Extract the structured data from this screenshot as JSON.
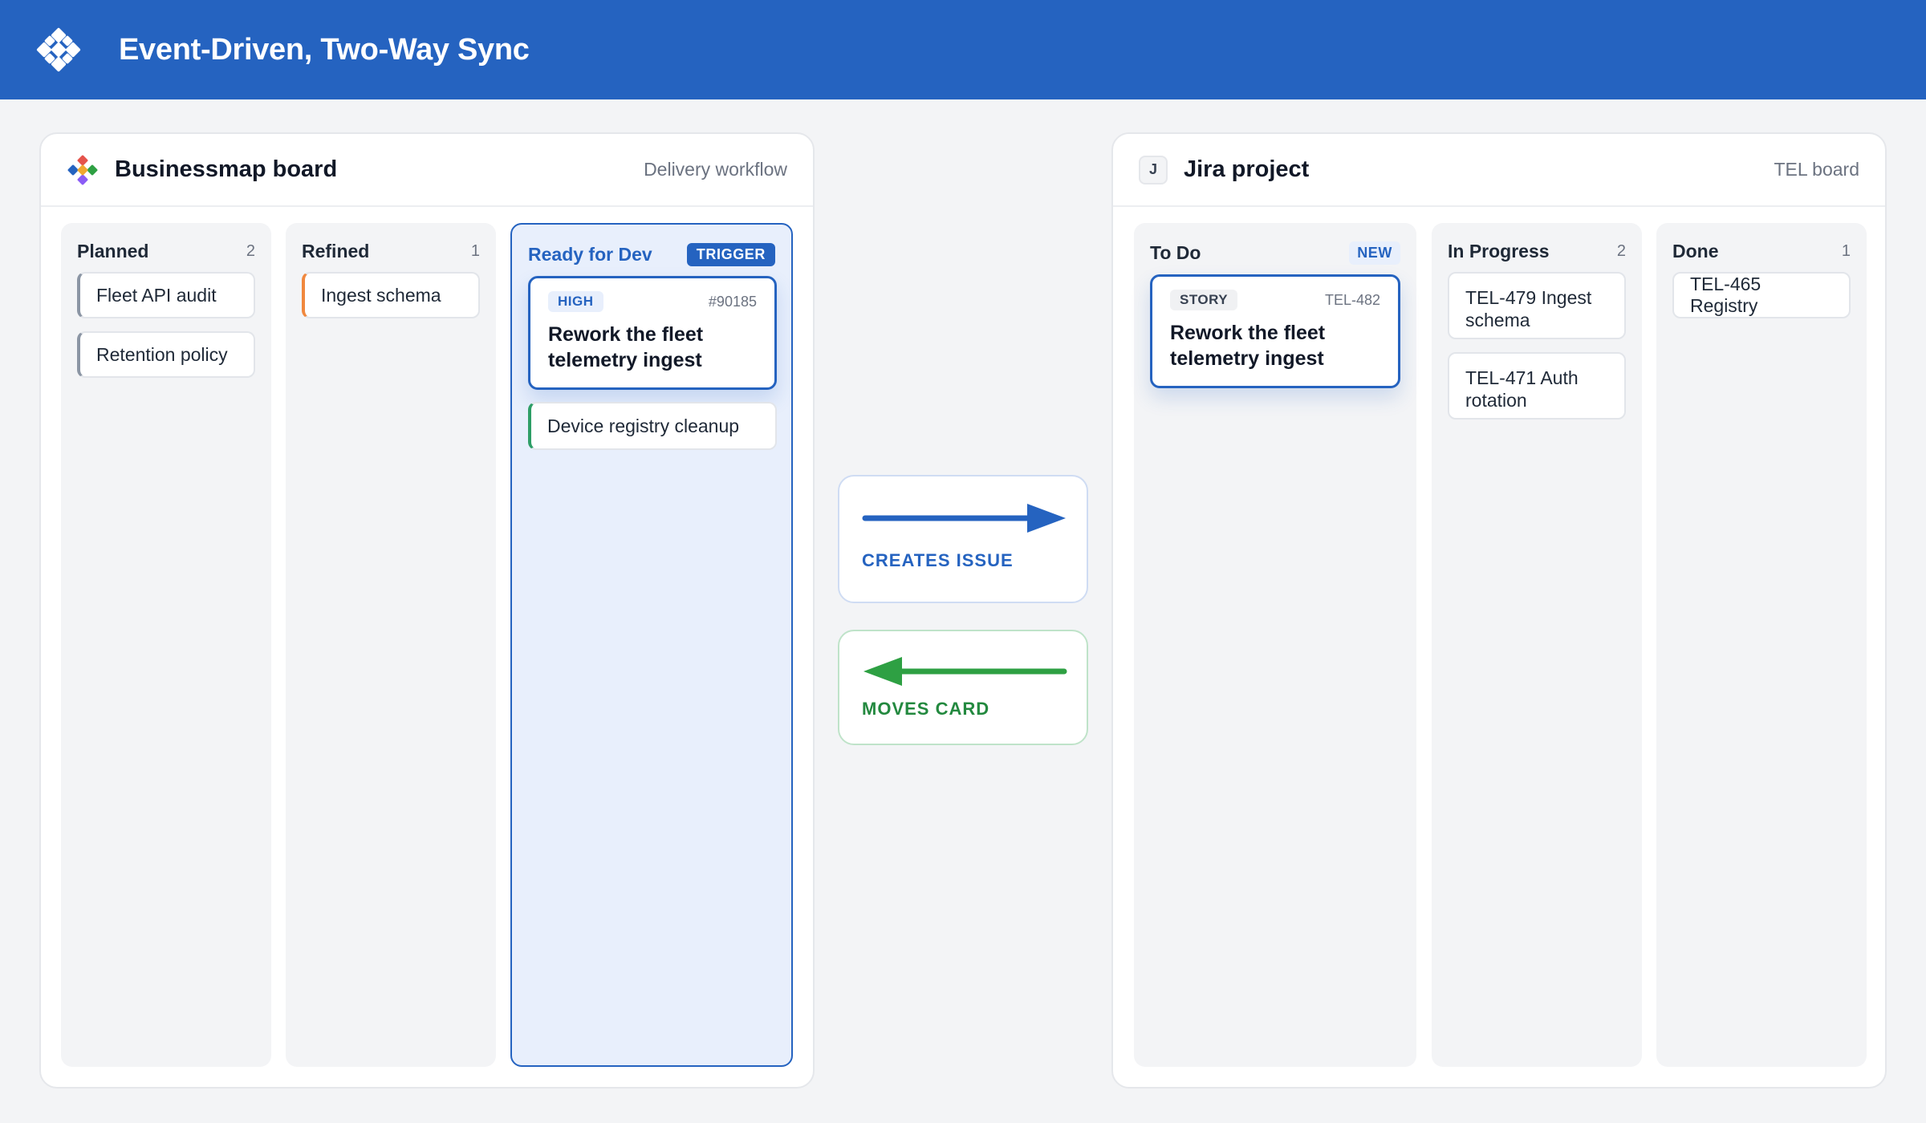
{
  "header": {
    "title": "Event-Driven, Two-Way Sync",
    "logo_icon": "businessmap-logo-icon",
    "color": "#2563c0"
  },
  "businessmap": {
    "title": "Businessmap board",
    "subtitle": "Delivery workflow",
    "columns": [
      {
        "name": "Planned",
        "count": "2",
        "cards": [
          {
            "label": "Fleet API audit",
            "accent": "#8b95a4"
          },
          {
            "label": "Retention policy",
            "accent": "#8b95a4"
          }
        ]
      },
      {
        "name": "Refined",
        "count": "1",
        "cards": [
          {
            "label": "Ingest schema",
            "accent": "#f0883e"
          }
        ]
      },
      {
        "name": "Ready for Dev",
        "badge": "TRIGGER",
        "feature_card": {
          "priority": "HIGH",
          "id": "#90185",
          "title": "Rework the fleet telemetry ingest"
        },
        "cards": [
          {
            "label": "Device registry cleanup",
            "accent": "#2e9e66"
          }
        ]
      }
    ]
  },
  "sync": {
    "creates_issue_label": "CREATES ISSUE",
    "creates_issue_color": "#2563c0",
    "moves_card_label": "MOVES CARD",
    "moves_card_color": "#2ea043"
  },
  "jira": {
    "icon_letter": "J",
    "title": "Jira project",
    "subtitle": "TEL board",
    "columns": [
      {
        "name": "To Do",
        "badge": "NEW",
        "feature_card": {
          "type": "STORY",
          "id": "TEL-482",
          "title": "Rework the fleet telemetry ingest"
        }
      },
      {
        "name": "In Progress",
        "count": "2",
        "cards": [
          {
            "label": "TEL-479 Ingest schema"
          },
          {
            "label": "TEL-471 Auth rotation"
          }
        ]
      },
      {
        "name": "Done",
        "count": "1",
        "cards": [
          {
            "label": "TEL-465 Registry"
          }
        ]
      }
    ]
  }
}
